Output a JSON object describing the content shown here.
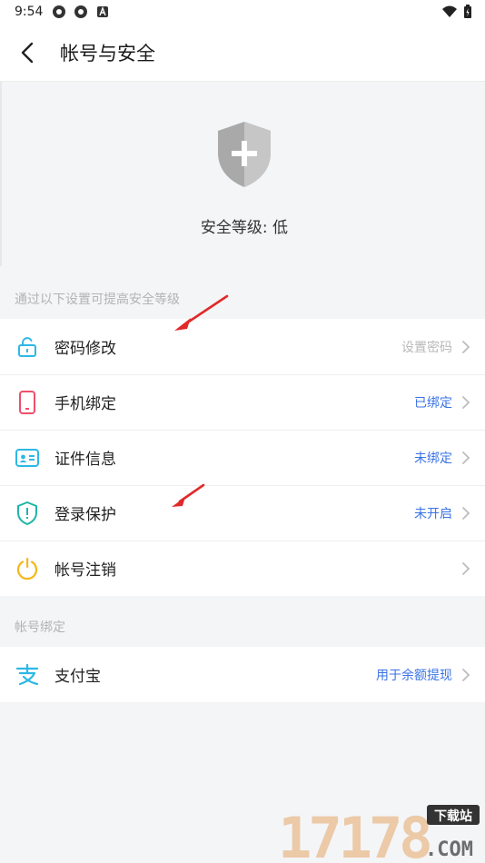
{
  "status_bar": {
    "time": "9:54"
  },
  "header": {
    "title": "帐号与安全"
  },
  "security": {
    "level_label": "安全等级: 低"
  },
  "sections": {
    "improve_hint": "通过以下设置可提高安全等级",
    "account_binding": "帐号绑定"
  },
  "settings": [
    {
      "label": "密码修改",
      "value": "设置密码",
      "icon": "lock-open-icon"
    },
    {
      "label": "手机绑定",
      "value": "已绑定",
      "icon": "phone-icon"
    },
    {
      "label": "证件信息",
      "value": "未绑定",
      "icon": "id-card-icon"
    },
    {
      "label": "登录保护",
      "value": "未开启",
      "icon": "shield-alert-icon"
    },
    {
      "label": "帐号注销",
      "value": "",
      "icon": "power-icon"
    }
  ],
  "binding": [
    {
      "label": "支付宝",
      "value": "用于余额提现",
      "icon": "alipay-icon"
    }
  ],
  "watermark": {
    "brand_number": "17178",
    "brand_tag": "下载站",
    "domain": ".COM"
  },
  "colors": {
    "accent_blue": "#3a73e6",
    "lock_cyan": "#2db8e6",
    "phone_red": "#ef4e6b",
    "shield_teal": "#1fb5a8",
    "power_yellow": "#f5b81c",
    "arrow_red": "#e02a2a"
  }
}
